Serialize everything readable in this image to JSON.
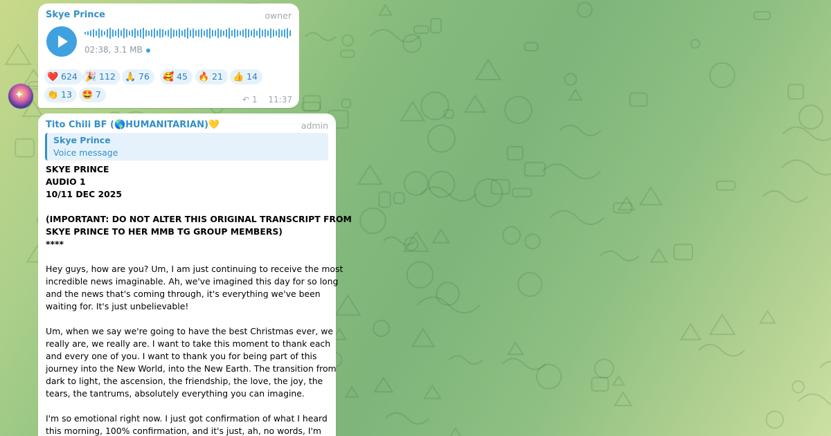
{
  "theme": {
    "accent": "#3390c8",
    "bubble": "#ffffff",
    "reaction_bg": "#e6f2fb"
  },
  "message1": {
    "sender": "Skye Prince",
    "role": "owner",
    "voice_meta": "02:38, 3.1 MB",
    "play_icon": "play-icon",
    "reactions": [
      {
        "emoji": "❤️",
        "icon": "heart-icon",
        "count": "624"
      },
      {
        "emoji": "🎉",
        "icon": "party-popper-icon",
        "count": "112"
      },
      {
        "emoji": "🙏",
        "icon": "praying-hands-icon",
        "count": "76"
      },
      {
        "emoji": "🥰",
        "icon": "smiling-face-hearts-icon",
        "count": "45"
      },
      {
        "emoji": "🔥",
        "icon": "fire-icon",
        "count": "21"
      },
      {
        "emoji": "👍",
        "icon": "thumbs-up-icon",
        "count": "14"
      },
      {
        "emoji": "👏",
        "icon": "clapping-hands-icon",
        "count": "13"
      },
      {
        "emoji": "🤩",
        "icon": "star-struck-icon",
        "count": "7"
      }
    ],
    "replies": "1",
    "time": "11:37"
  },
  "message2": {
    "sender": "Tito Chili BF (🌎HUMANITARIAN)💛",
    "role": "admin",
    "quote_name": "Skye Prince",
    "quote_text": "Voice message",
    "lines": [
      {
        "text": "SKYE PRINCE",
        "bold": true
      },
      {
        "text": "AUDIO 1",
        "bold": true
      },
      {
        "text": "10/11 DEC 2025",
        "bold": true
      },
      {
        "text": "",
        "bold": false
      },
      {
        "text": "(IMPORTANT: DO NOT ALTER THIS ORIGINAL TRANSCRIPT FROM",
        "bold": true
      },
      {
        "text": "SKYE PRINCE TO HER MMB TG GROUP MEMBERS)",
        "bold": true
      },
      {
        "text": "****",
        "bold": true
      },
      {
        "text": "",
        "bold": false
      },
      {
        "text": "Hey guys, how are you? Um, I am just continuing to receive the most",
        "bold": false
      },
      {
        "text": "incredible news imaginable. Ah, we've imagined this day for so long",
        "bold": false
      },
      {
        "text": "and the news that's coming through, it's everything we've been",
        "bold": false
      },
      {
        "text": "waiting for. It's just unbelievable!",
        "bold": false
      },
      {
        "text": "",
        "bold": false
      },
      {
        "text": "Um, when we say we're going to have the best Christmas ever, we",
        "bold": false
      },
      {
        "text": "really are, we really are.  I want to take this moment to thank each",
        "bold": false
      },
      {
        "text": "and every one of you. I want to thank you for being part of this",
        "bold": false
      },
      {
        "text": "journey into the New World, into the New Earth.  The transition from",
        "bold": false
      },
      {
        "text": "dark to light, the ascension, the friendship, the love, the joy, the",
        "bold": false
      },
      {
        "text": "tears, the tantrums, absolutely everything you can imagine.",
        "bold": false
      },
      {
        "text": "",
        "bold": false
      },
      {
        "text": "I'm so emotional right now. I just got confirmation of what I heard",
        "bold": false
      },
      {
        "text": "this morning, 100% confirmation, and it's just, ah, no words, I'm",
        "bold": false
      }
    ]
  }
}
